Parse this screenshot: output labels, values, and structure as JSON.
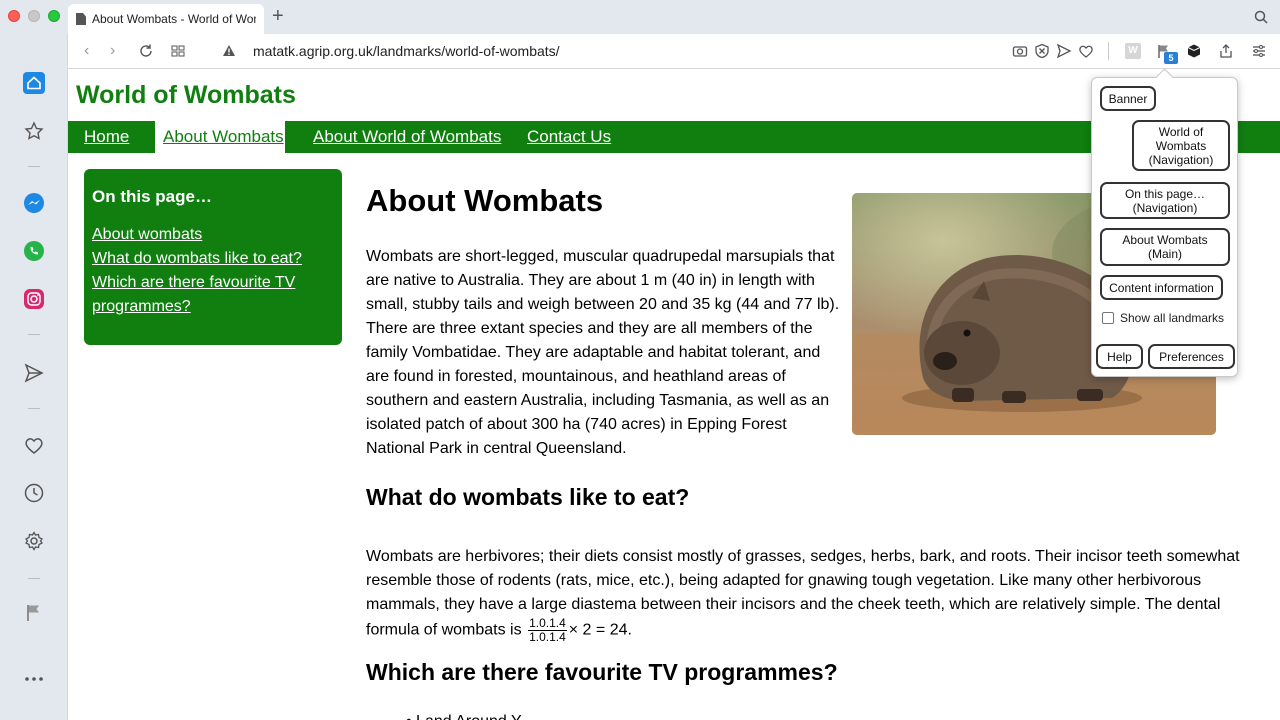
{
  "browser": {
    "tab_title": "About Wombats - World of Wombats",
    "url": "matatk.agrip.org.uk/landmarks/world-of-wombats/",
    "extension_badge": "5"
  },
  "site": {
    "title": "World of Wombats",
    "nav": [
      "Home",
      "About Wombats",
      "About World of Wombats",
      "Contact Us"
    ]
  },
  "onpage": {
    "heading": "On this page…",
    "links": [
      "About wombats",
      "What do wombats like to eat?",
      "Which are there favourite TV programmes?"
    ]
  },
  "main": {
    "h1": "About Wombats",
    "p1": "Wombats are short-legged, muscular quadrupedal marsupials that are native to Australia. They are about 1 m (40 in) in length with small, stubby tails and weigh between 20 and 35 kg (44 and 77 lb). There are three extant species and they are all members of the family Vombatidae. They are adaptable and habitat tolerant, and are found in forested, mountainous, and heathland areas of southern and eastern Australia, including Tasmania, as well as an isolated patch of about 300 ha (740 acres) in Epping Forest National Park in central Queensland.",
    "h2_eat": "What do wombats like to eat?",
    "p2_start": "Wombats are herbivores; their diets consist mostly of grasses, sedges, herbs, bark, and roots. Their incisor teeth somewhat resemble those of rodents (rats, mice, etc.), being adapted for gnawing tough vegetation. Like many other herbivorous mammals, they have a large diastema between their incisors and the cheek teeth, which are relatively simple. The dental formula of wombats is",
    "formula_num": "1.0.1.4",
    "formula_den": "1.0.1.4",
    "formula_rest": "× 2 = 24.",
    "h2_tv": "Which are there favourite TV programmes?"
  },
  "landmarks_popup": {
    "banner": "Banner",
    "nav1": "World of Wombats (Navigation)",
    "nav2": "On this page… (Navigation)",
    "main": "About Wombats (Main)",
    "content_info": "Content information",
    "show_all": "Show all landmarks",
    "help": "Help",
    "preferences": "Preferences"
  }
}
